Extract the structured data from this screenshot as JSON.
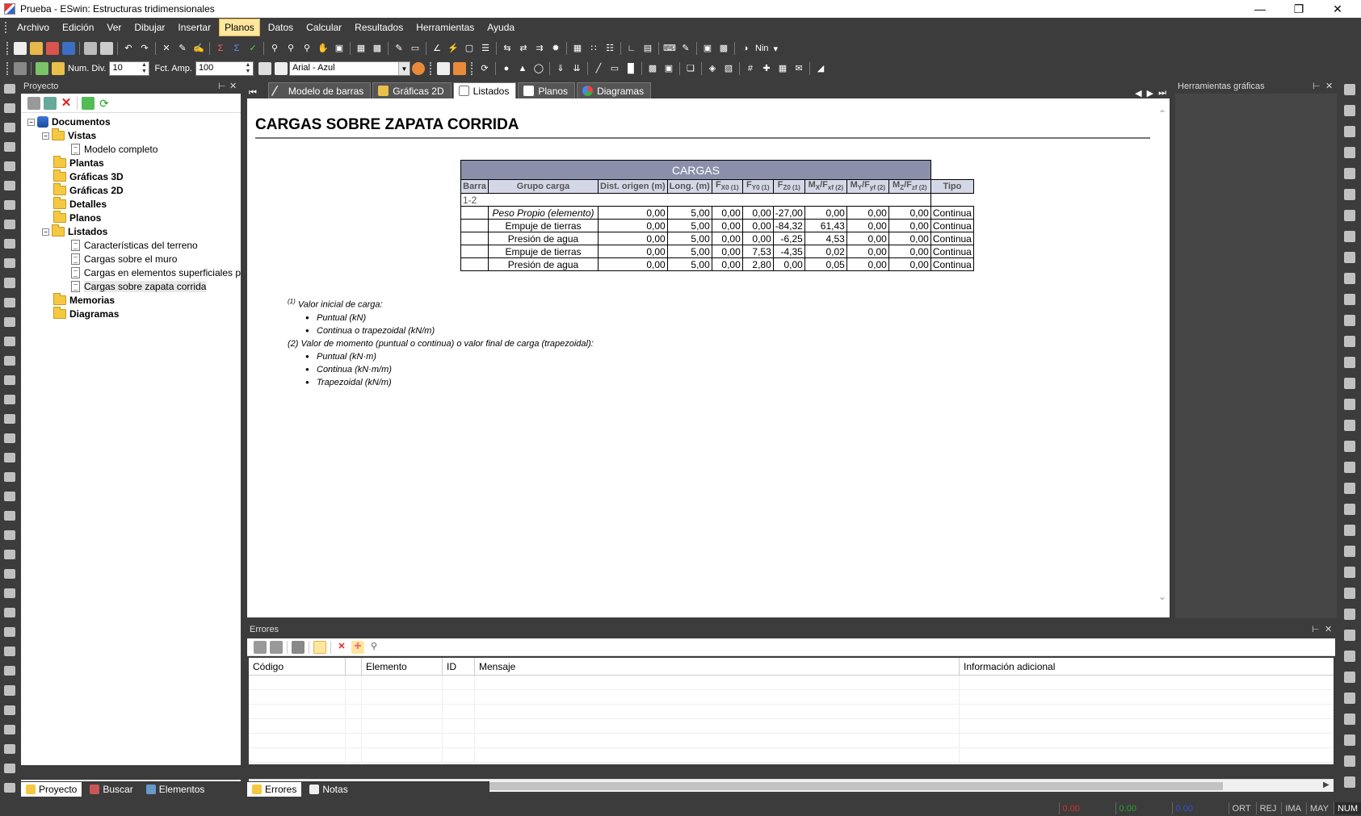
{
  "window": {
    "title": "Prueba - ESwin: Estructuras tridimensionales"
  },
  "menu": [
    "Archivo",
    "Edición",
    "Ver",
    "Dibujar",
    "Insertar",
    "Planos",
    "Datos",
    "Calcular",
    "Resultados",
    "Herramientas",
    "Ayuda"
  ],
  "toolbar2": {
    "num_div_label": "Num. Div.",
    "num_div_value": "10",
    "fct_amp_label": "Fct. Amp.",
    "fct_amp_value": "100",
    "font_combo": "Arial - Azul",
    "nin_label": "Nin"
  },
  "project_panel": {
    "title": "Proyecto",
    "tree": {
      "root": "Documentos",
      "vistas": "Vistas",
      "modelo_completo": "Modelo completo",
      "plantas": "Plantas",
      "graficas3d": "Gráficas 3D",
      "graficas2d": "Gráficas 2D",
      "detalles": "Detalles",
      "planos": "Planos",
      "listados": "Listados",
      "listados_items": [
        "Características del terreno",
        "Cargas sobre el muro",
        "Cargas en elementos superficiales p",
        "Cargas sobre zapata corrida"
      ],
      "memorias": "Memorias",
      "diagramas": "Diagramas"
    },
    "bottom_tabs": [
      "Proyecto",
      "Buscar",
      "Elementos"
    ]
  },
  "doc_tabs": [
    "Modelo de barras",
    "Gráficas 2D",
    "Listados",
    "Planos",
    "Diagramas"
  ],
  "document": {
    "title": "CARGAS SOBRE ZAPATA CORRIDA",
    "table": {
      "caption": "CARGAS",
      "headers": {
        "barra": "Barra",
        "grupo": "Grupo carga",
        "dist": "Dist. origen (m)",
        "long": "Long. (m)",
        "fx0": "F",
        "fx0_sub": "X0 (1)",
        "fy0": "F",
        "fy0_sub": "Y0 (1)",
        "fz0": "F",
        "fz0_sub": "Z0 (1)",
        "mx": "M",
        "mx_sub1": "X",
        "mx_mid": "/F",
        "mx_sub2": "xf (2)",
        "my": "M",
        "my_sub1": "Y",
        "my_mid": "/F",
        "my_sub2": "yf (2)",
        "mz": "M",
        "mz_sub1": "Z",
        "mz_mid": "/F",
        "mz_sub2": "zf (2)",
        "tipo": "Tipo"
      },
      "group_label": "1-2",
      "rows": [
        [
          "Peso Propio (elemento)",
          "0,00",
          "5,00",
          "0,00",
          "0,00",
          "-27,00",
          "0,00",
          "0,00",
          "0,00",
          "Continua"
        ],
        [
          "Empuje de tierras",
          "0,00",
          "5,00",
          "0,00",
          "0,00",
          "-84,32",
          "61,43",
          "0,00",
          "0,00",
          "Continua"
        ],
        [
          "Presión de agua",
          "0,00",
          "5,00",
          "0,00",
          "0,00",
          "-6,25",
          "4,53",
          "0,00",
          "0,00",
          "Continua"
        ],
        [
          "Empuje de tierras",
          "0,00",
          "5,00",
          "0,00",
          "7,53",
          "-4,35",
          "0,02",
          "0,00",
          "0,00",
          "Continua"
        ],
        [
          "Presión de agua",
          "0,00",
          "5,00",
          "0,00",
          "2,80",
          "0,00",
          "0,05",
          "0,00",
          "0,00",
          "Continua"
        ]
      ]
    },
    "notes": {
      "n1_mark": "(1)",
      "n1": "Valor inicial de carga:",
      "n1_items": [
        "Puntual (kN)",
        "Continua o trapezoidal (kN/m)"
      ],
      "n2": "(2) Valor de momento (puntual o continua) o valor final de carga (trapezoidal):",
      "n2_items": [
        "Puntual (kN·m)",
        "Continua (kN·m/m)",
        "Trapezoidal (kN/m)"
      ]
    }
  },
  "graphic_tools_panel": {
    "title": "Herramientas gráficas"
  },
  "errors_panel": {
    "title": "Errores",
    "columns": [
      "Código",
      "Elemento",
      "ID",
      "Mensaje",
      "Información adicional"
    ],
    "bottom_tabs": [
      "Errores",
      "Notas"
    ]
  },
  "statusbar": {
    "v1": "0.00",
    "v2": "0.00",
    "v3": "0.00",
    "ort": "ORT",
    "rej": "REJ",
    "ima": "IMA",
    "may": "MAY",
    "num": "NUM"
  },
  "colors": {
    "menu_active": "#ffe7a0",
    "table_caption": "#8a90aa",
    "table_header": "#d4d7e6",
    "status_red": "#d03030",
    "status_green": "#2aa02a",
    "status_blue": "#3050d0"
  }
}
